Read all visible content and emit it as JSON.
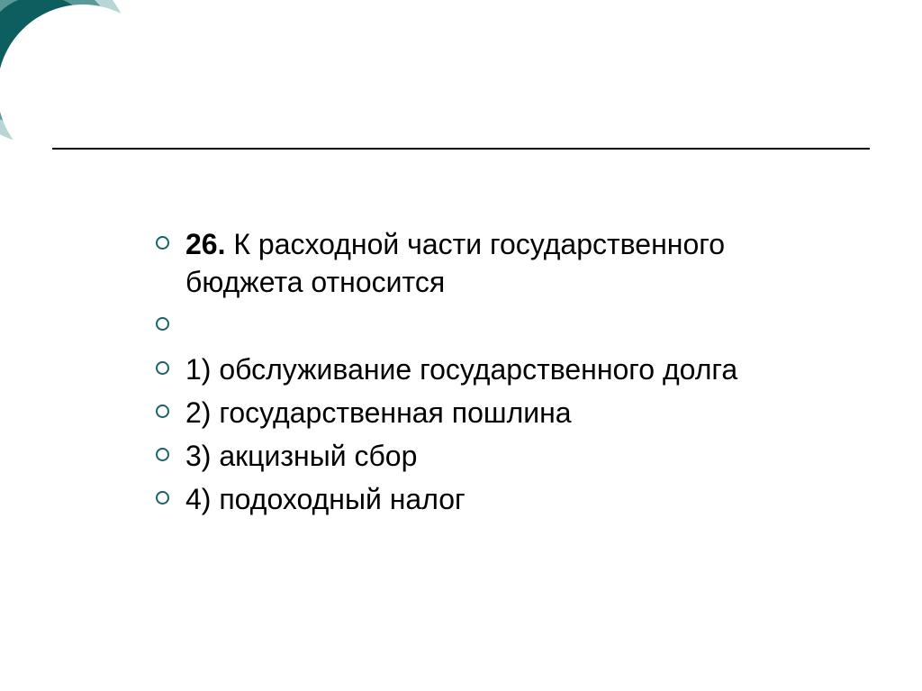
{
  "question": {
    "number": "26.",
    "text": "К расходной части государственного бюджета относится"
  },
  "options": [
    {
      "label": "1) обслуживание государственного долга"
    },
    {
      "label": "2) государственная пошлина"
    },
    {
      "label": "3) акцизный сбор"
    },
    {
      "label": "4) подоходный налог"
    }
  ]
}
